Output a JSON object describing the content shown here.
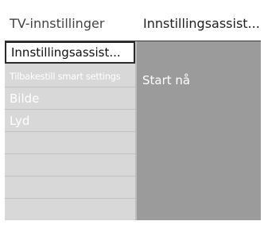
{
  "header": {
    "title": "TV-innstillinger",
    "current": "Innstillingsassist..."
  },
  "menu": {
    "items": [
      {
        "label": "Innstillingsassist..."
      },
      {
        "label": "Tilbakestill smart settings"
      },
      {
        "label": "Bilde"
      },
      {
        "label": "Lyd"
      }
    ]
  },
  "pane": {
    "action": "Start nå"
  },
  "colors": {
    "menu_bg": "#d8d8d8",
    "pane_bg": "#9b9b9b",
    "selected_bg": "#ffffff"
  }
}
